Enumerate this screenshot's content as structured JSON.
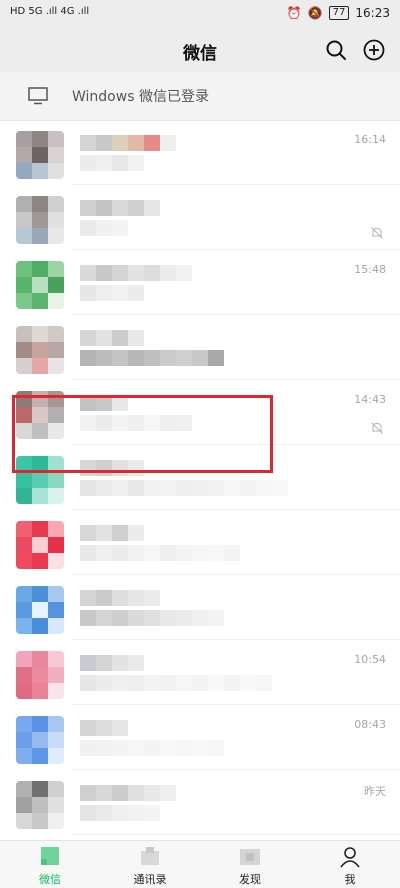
{
  "status_bar": {
    "left_text": "HD 5G .ıll 4G .ıll",
    "battery": "77",
    "time": "16:23"
  },
  "header": {
    "title": "微信",
    "search_icon": "search-icon",
    "add_icon": "plus-circle-icon"
  },
  "banner": {
    "icon": "monitor-icon",
    "text": "Windows 微信已登录"
  },
  "chats": [
    {
      "time": "16:14",
      "muted": false
    },
    {
      "time": "",
      "muted": true
    },
    {
      "time": "15:48",
      "muted": false
    },
    {
      "time": "",
      "muted": false
    },
    {
      "time": "14:43",
      "muted": true
    },
    {
      "time": "",
      "muted": false
    },
    {
      "time": "",
      "muted": false
    },
    {
      "time": "",
      "muted": false
    },
    {
      "time": "10:54",
      "muted": false
    },
    {
      "time": "08:43",
      "muted": false
    },
    {
      "time": "昨天",
      "muted": false
    }
  ],
  "tabs": [
    {
      "label": "微信",
      "icon": "chat-icon",
      "active": true
    },
    {
      "label": "通讯录",
      "icon": "contacts-icon",
      "active": false
    },
    {
      "label": "发现",
      "icon": "discover-icon",
      "active": false
    },
    {
      "label": "我",
      "icon": "person-icon",
      "active": false
    }
  ],
  "colors": {
    "accent": "#07c160",
    "highlight": "#e3262e",
    "header_bg": "#ededed"
  }
}
